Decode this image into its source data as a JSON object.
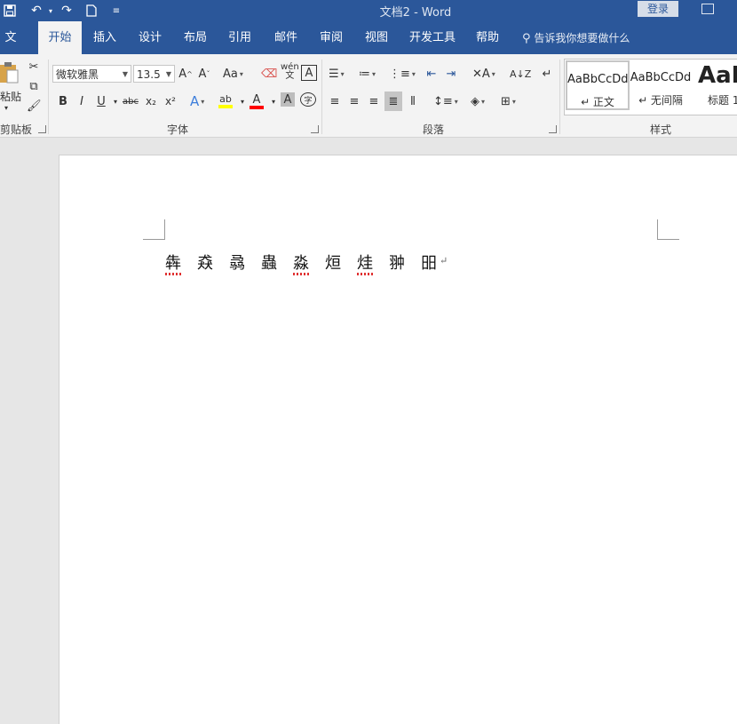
{
  "title_bar": {
    "document_title": "文档2  -  Word",
    "login_label": "登录"
  },
  "tabs": [
    "文件",
    "开始",
    "插入",
    "设计",
    "布局",
    "引用",
    "邮件",
    "审阅",
    "视图",
    "开发工具",
    "帮助"
  ],
  "active_tab": "开始",
  "tell_me": "告诉我你想要做什么",
  "clipboard": {
    "paste_label": "粘贴",
    "group_label": "剪贴板"
  },
  "font": {
    "font_name": "微软雅黑",
    "font_size": "13.5",
    "group_label": "字体",
    "change_case_label": "Aa",
    "phonetic_label": "wén",
    "bold": "B",
    "italic": "I",
    "underline": "U",
    "strikethrough": "abc",
    "subscript": "x₂",
    "superscript": "x²"
  },
  "paragraph": {
    "group_label": "段落"
  },
  "styles": {
    "group_label": "样式",
    "items": [
      {
        "sample": "AaBbCcDd",
        "name": "↵ 正文"
      },
      {
        "sample": "AaBbCcDd",
        "name": "↵ 无间隔"
      },
      {
        "sample": "AaB",
        "name": "标题 1"
      }
    ]
  },
  "document": {
    "characters": [
      "犇",
      "猋",
      "骉",
      "蟲",
      "淼",
      "烜",
      "烓",
      "翀",
      "昍"
    ],
    "spell_flagged": [
      0,
      4,
      6
    ],
    "paragraph_mark": "↵"
  },
  "colors": {
    "accent": "#2b579a",
    "highlight": "#ffff00",
    "font_color": "#ff0000"
  }
}
